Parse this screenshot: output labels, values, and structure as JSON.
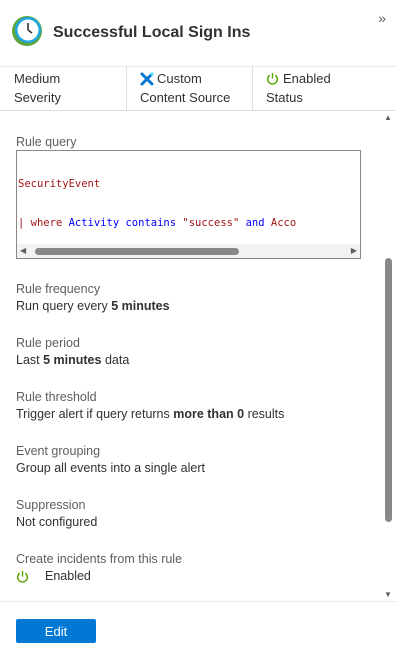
{
  "header": {
    "title": "Successful Local Sign Ins",
    "collapse_icon": "»"
  },
  "summary": {
    "severity": {
      "value": "Medium",
      "label": "Severity"
    },
    "source": {
      "value": "Custom",
      "label": "Content Source"
    },
    "status": {
      "value": "Enabled",
      "label": "Status"
    }
  },
  "rule_query": {
    "label": "Rule query",
    "line1": "SecurityEvent",
    "line2_pipe": "| ",
    "line2_where": "where",
    "line2_field": " Activity ",
    "line2_contains": "contains",
    "line2_string": " \"success\" ",
    "line2_and": "and",
    "line2_rest": " Acco"
  },
  "rule_frequency": {
    "label": "Rule frequency",
    "prefix": "Run query every ",
    "bold": "5 minutes"
  },
  "rule_period": {
    "label": "Rule period",
    "prefix": "Last ",
    "bold": "5 minutes",
    "suffix": " data"
  },
  "rule_threshold": {
    "label": "Rule threshold",
    "prefix": "Trigger alert if query returns ",
    "bold": "more than 0",
    "suffix": " results"
  },
  "event_grouping": {
    "label": "Event grouping",
    "value": "Group all events into a single alert"
  },
  "suppression": {
    "label": "Suppression",
    "value": "Not configured"
  },
  "incidents": {
    "label": "Create incidents from this rule",
    "value": "Enabled"
  },
  "footer": {
    "edit_label": "Edit"
  },
  "colors": {
    "accent": "#0078d4",
    "enabled_green": "#57a300",
    "custom_blue": "#0078d4"
  }
}
